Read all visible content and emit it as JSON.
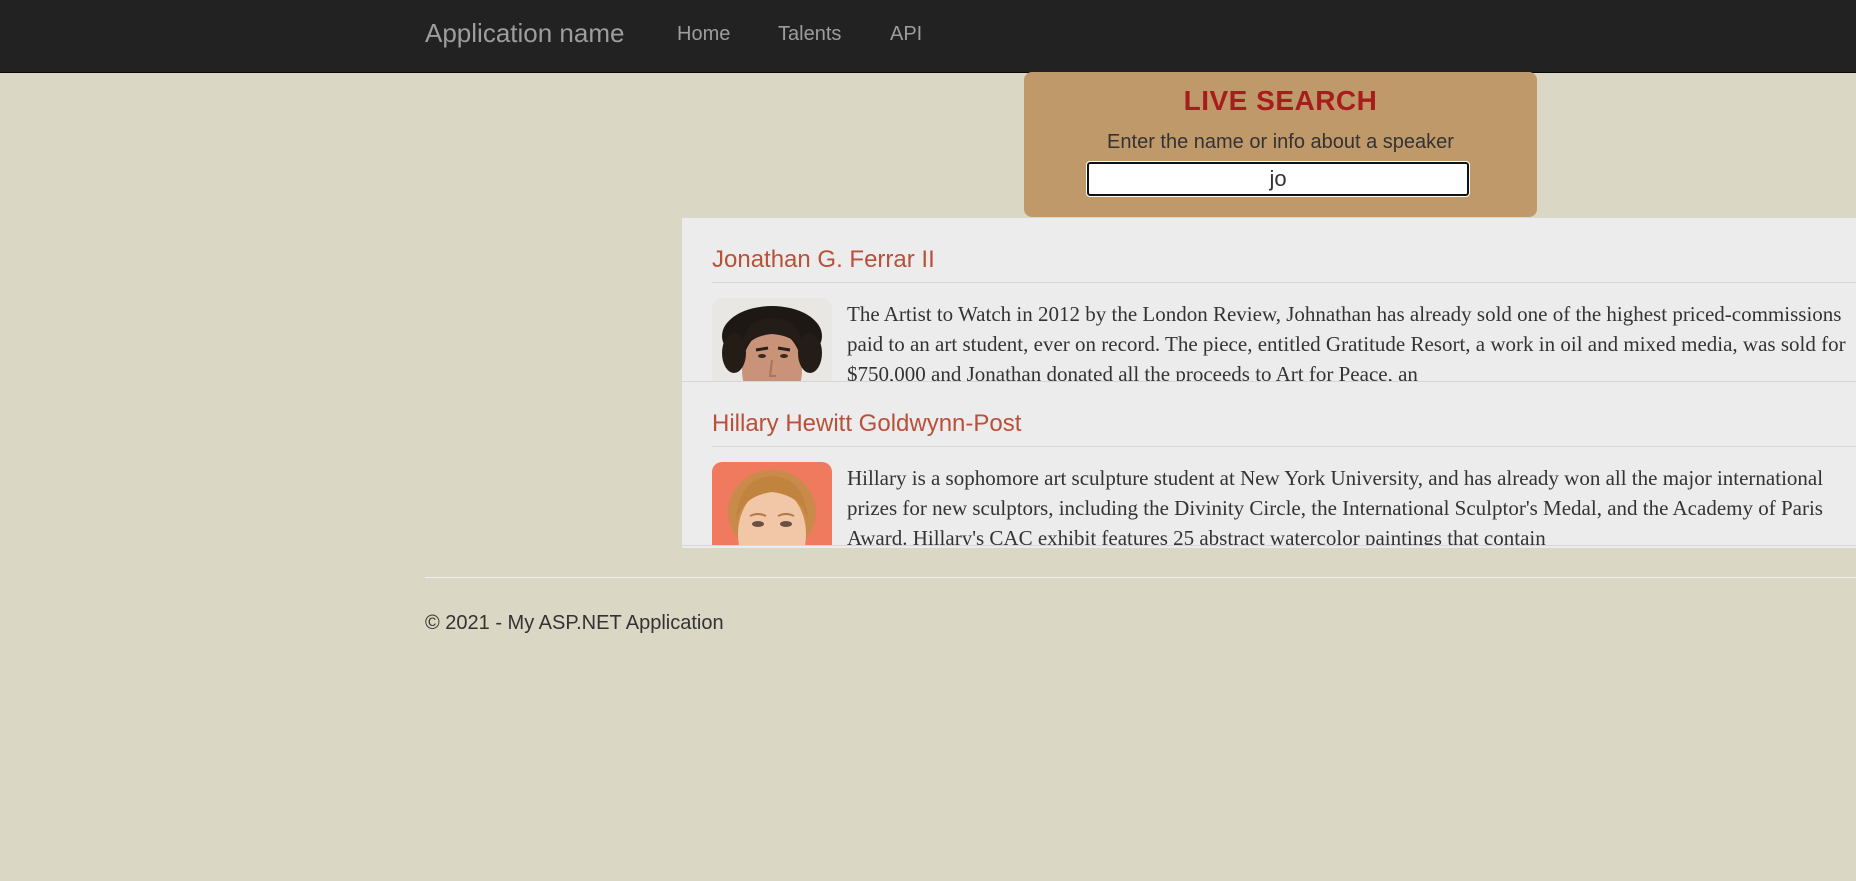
{
  "navbar": {
    "brand": "Application name",
    "links": [
      {
        "label": "Home"
      },
      {
        "label": "Talents"
      },
      {
        "label": "API"
      }
    ]
  },
  "live_search": {
    "title": "LIVE SEARCH",
    "label": "Enter the name or info about a speaker",
    "input_value": "jo"
  },
  "results": [
    {
      "name": "Jonathan G. Ferrar II",
      "bio": "The Artist to Watch in 2012 by the London Review, Johnathan has already sold one of the highest priced-commissions paid to an art student, ever on record. The piece, entitled Gratitude Resort, a work in oil and mixed media, was sold for $750,000 and Jonathan donated all the proceeds to Art for Peace, an"
    },
    {
      "name": "Hillary Hewitt Goldwynn-Post",
      "bio": "Hillary is a sophomore art sculpture student at New York University, and has already won all the major international prizes for new sculptors, including the Divinity Circle, the International Sculptor's Medal, and the Academy of Paris Award. Hillary's CAC exhibit features 25 abstract watercolor paintings that contain"
    }
  ],
  "footer": {
    "copyright": "© 2021 - My ASP.NET Application"
  },
  "colors": {
    "page_bg": "#dad7c5",
    "navbar_bg": "#222222",
    "search_box_bg": "#c0996a",
    "search_title": "#a71d1d",
    "result_name": "#b8503a",
    "results_bg": "#ececec"
  }
}
